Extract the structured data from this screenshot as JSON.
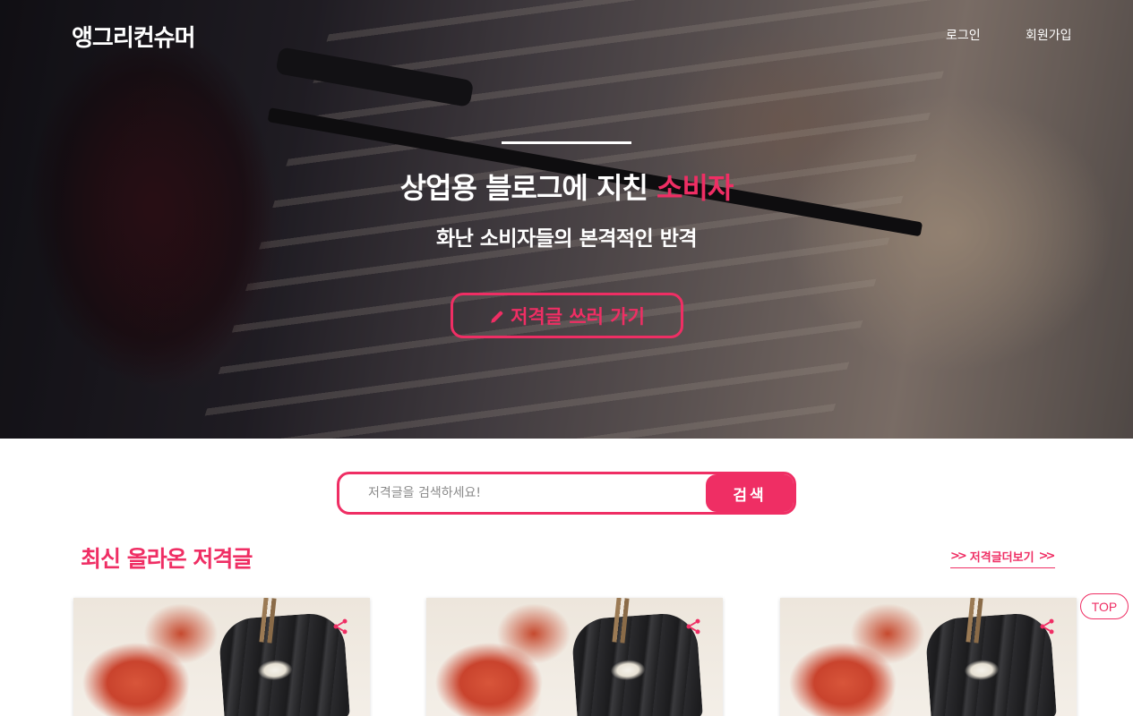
{
  "header": {
    "brand": "앵그리컨슈머",
    "nav": {
      "login": "로그인",
      "signup": "회원가입"
    }
  },
  "hero": {
    "title_main": "상업용 블로그에 지친 ",
    "title_accent": "소비자",
    "subtitle": "화난 소비자들의 본격적인 반격",
    "cta_label": "저격글 쓰러 가기",
    "cta_icon": "pencil-icon"
  },
  "search": {
    "placeholder": "저격글을 검색하세요!",
    "button_label": "검색"
  },
  "latest": {
    "title": "최신 올라온 저격글",
    "more_label": "저격글더보기",
    "cards": [
      {
        "icon": "share-icon"
      },
      {
        "icon": "share-icon"
      },
      {
        "icon": "share-icon"
      }
    ]
  },
  "top_button": "TOP",
  "colors": {
    "accent": "#ef2e64",
    "text_light": "#ffffff"
  }
}
